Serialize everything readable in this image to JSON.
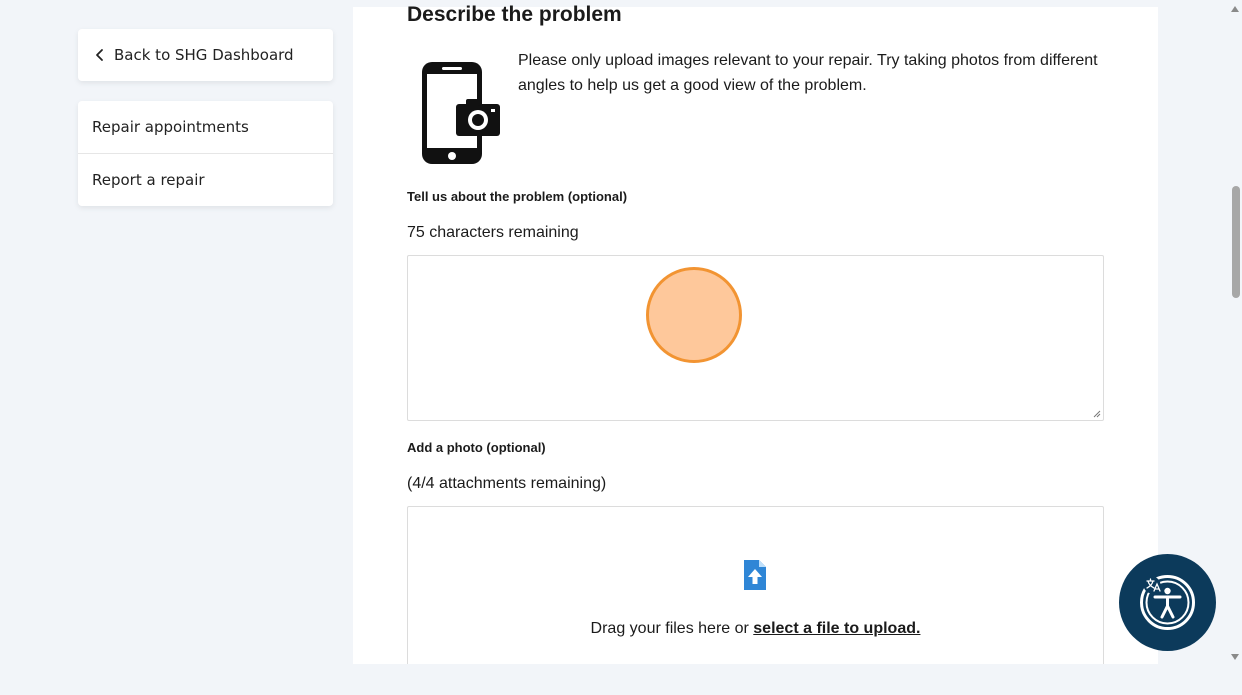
{
  "sidebar": {
    "back_label": "Back to SHG Dashboard",
    "items": [
      {
        "label": "Repair appointments"
      },
      {
        "label": "Report a repair"
      }
    ]
  },
  "main": {
    "heading": "Describe the problem",
    "intro_text": "Please only upload images relevant to your repair. Try taking photos from different angles to help us get a good view of the problem.",
    "problem_field": {
      "label": "Tell us about the problem (optional)",
      "remaining": "75 characters remaining",
      "value": ""
    },
    "photo": {
      "label": "Add a photo (optional)",
      "remaining": "(4/4 attachments remaining)",
      "drop_text": "Drag your files here or ",
      "drop_link": "select a file to upload."
    }
  },
  "icons": {
    "back": "chevron-left-icon",
    "phone": "phone-camera-icon",
    "upload": "file-upload-icon",
    "accessibility": "accessibility-icon"
  },
  "colors": {
    "page_bg": "#f2f5f9",
    "panel_bg": "#ffffff",
    "accent_upload": "#2f86d6",
    "a11y_bg": "#0c3a5b",
    "click_marker_fill": "#fec89b",
    "click_marker_border": "#f29432"
  }
}
